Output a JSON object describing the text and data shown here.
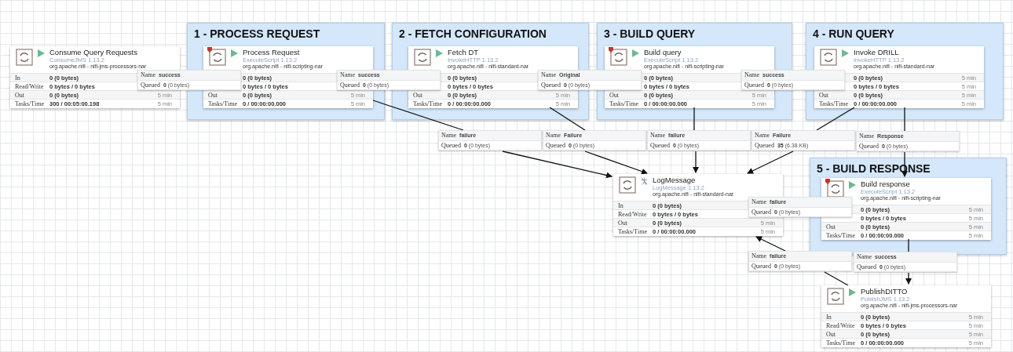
{
  "groups": [
    {
      "title": "1 - PROCESS REQUEST"
    },
    {
      "title": "2 - FETCH CONFIGURATION"
    },
    {
      "title": "3 - BUILD QUERY"
    },
    {
      "title": "4 - RUN QUERY"
    },
    {
      "title": "5 - BUILD RESPONSE"
    }
  ],
  "processors": [
    {
      "name": "Consume Query Requests",
      "type": "ConsumeJMS 1.13.2",
      "bundle": "org.apache.nifi - nifi-jms-processors-nar",
      "running": true,
      "restricted": false,
      "stats": [
        {
          "label": "In",
          "value": "0 (0 bytes)"
        },
        {
          "label": "Read/Write",
          "value": "0 bytes / 0 bytes"
        },
        {
          "label": "Out",
          "value": "0 (0 bytes)",
          "time": "5 min"
        },
        {
          "label": "Tasks/Time",
          "value": "300 / 00:05:00.198",
          "time": "5 min"
        }
      ]
    },
    {
      "name": "Process Request",
      "type": "ExecuteScript 1.13.2",
      "bundle": "org.apache.nifi - nifi-scripting-nar",
      "running": true,
      "restricted": true,
      "stats": [
        {
          "value": "0 (0 bytes)"
        },
        {
          "value": "0 bytes / 0 bytes"
        },
        {
          "label": "Out",
          "value": "0 (0 bytes)",
          "time": "5 min"
        },
        {
          "label": "Tasks/Time",
          "value": "0 / 00:00:00.000",
          "time": "5 min"
        }
      ]
    },
    {
      "name": "Fetch DT",
      "type": "InvokeHTTP 1.13.2",
      "bundle": "org.apache.nifi - nifi-standard-nar",
      "running": true,
      "restricted": false,
      "stats": [
        {
          "value": "0 (0 bytes)"
        },
        {
          "value": "0 bytes / 0 bytes"
        },
        {
          "label": "Out",
          "value": "0 (0 bytes)",
          "time": "5 min"
        },
        {
          "label": "Tasks/Time",
          "value": "0 / 00:00:00.000",
          "time": "5 min"
        }
      ]
    },
    {
      "name": "Build query",
      "type": "ExecuteScript 1.13.2",
      "bundle": "org.apache.nifi - nifi-scripting-nar",
      "running": true,
      "restricted": true,
      "stats": [
        {
          "value": "0 (0 bytes)"
        },
        {
          "value": "0 bytes / 0 bytes"
        },
        {
          "label": "Out",
          "value": "0 (0 bytes)",
          "time": "5 min"
        },
        {
          "label": "Tasks/Time",
          "value": "0 / 00:00:00.000",
          "time": "5 min"
        }
      ]
    },
    {
      "name": "Invoke DRILL",
      "type": "InvokeHTTP 1.13.2",
      "bundle": "org.apache.nifi - nifi-standard-nar",
      "running": true,
      "restricted": false,
      "stats": [
        {
          "value": "0 (0 bytes)",
          "time": "5 min"
        },
        {
          "value": "0 bytes / 0 bytes",
          "time": "5 min"
        },
        {
          "label": "Out",
          "value": "0 (0 bytes)",
          "time": "5 min"
        },
        {
          "label": "Tasks/Time",
          "value": "0 / 00:00:00.000",
          "time": "5 min"
        }
      ]
    },
    {
      "name": "LogMessage",
      "type": "LogMessage 1.13.2",
      "bundle": "org.apache.nifi - nifi-standard-nar",
      "running": false,
      "restricted": false,
      "stats": [
        {
          "label": "In",
          "value": "0 (0 bytes)"
        },
        {
          "label": "Read/Write",
          "value": "0 bytes / 0 bytes"
        },
        {
          "label": "Out",
          "value": "0 (0 bytes)",
          "time": "5 min"
        },
        {
          "label": "Tasks/Time",
          "value": "0 / 00:00:00.000",
          "time": "5 min"
        }
      ]
    },
    {
      "name": "Build response",
      "type": "ExecuteScript 1.13.2",
      "bundle": "org.apache.nifi - nifi-scripting-nar",
      "running": true,
      "restricted": true,
      "stats": [
        {
          "value": "0 (0 bytes)",
          "time": "5 min"
        },
        {
          "value": "0 bytes / 0 bytes",
          "time": "5 min"
        },
        {
          "label": "Out",
          "value": "0 (0 bytes)",
          "time": "5 min"
        },
        {
          "label": "Tasks/Time",
          "value": "0 / 00:00:00.000",
          "time": "5 min"
        }
      ]
    },
    {
      "name": "PublishDITTO",
      "type": "PublishJMS 1.13.2",
      "bundle": "org.apache.nifi - nifi-jms-processors-nar",
      "running": true,
      "restricted": false,
      "stats": [
        {
          "label": "In",
          "value": "0 (0 bytes)",
          "time": "5 min"
        },
        {
          "label": "Read/Write",
          "value": "0 bytes / 0 bytes",
          "time": "5 min"
        },
        {
          "label": "Out",
          "value": "0 (0 bytes)",
          "time": "5 min"
        },
        {
          "label": "Tasks/Time",
          "value": "0 / 00:00:00.000",
          "time": "5 min"
        }
      ]
    }
  ],
  "connections": [
    {
      "name_label": "Name",
      "name": "success",
      "queued_label": "Queued",
      "count": "0",
      "size": "(0 bytes)"
    },
    {
      "name_label": "Name",
      "name": "success",
      "queued_label": "Queued",
      "count": "0",
      "size": "(0 bytes)"
    },
    {
      "name_label": "Name",
      "name": "Original",
      "queued_label": "Queued",
      "count": "0",
      "size": "(0 bytes)"
    },
    {
      "name_label": "Name",
      "name": "success",
      "queued_label": "Queued",
      "count": "0",
      "size": "(0 bytes)"
    },
    {
      "name_label": "Name",
      "name": "failure",
      "queued_label": "Queued",
      "count": "0",
      "size": "(0 bytes)"
    },
    {
      "name_label": "Name",
      "name": "Failure",
      "queued_label": "Queued",
      "count": "0",
      "size": "(0 bytes)"
    },
    {
      "name_label": "Name",
      "name": "failure",
      "queued_label": "Queued",
      "count": "0",
      "size": "(0 bytes)"
    },
    {
      "name_label": "Name",
      "name": "Failure",
      "queued_label": "Queued",
      "count": "35",
      "size": "(6.38 KB)"
    },
    {
      "name_label": "Name",
      "name": "Response",
      "queued_label": "Queued",
      "count": "0",
      "size": "(0 bytes)"
    },
    {
      "name_label": "Name",
      "name": "failure",
      "queued_label": "Queued",
      "count": "0",
      "size": "(0 bytes)"
    },
    {
      "name_label": "Name",
      "name": "failure",
      "queued_label": "Queued",
      "count": "0",
      "size": "(0 bytes)"
    },
    {
      "name_label": "Name",
      "name": "success",
      "queued_label": "Queued",
      "count": "0",
      "size": "(0 bytes)"
    }
  ]
}
